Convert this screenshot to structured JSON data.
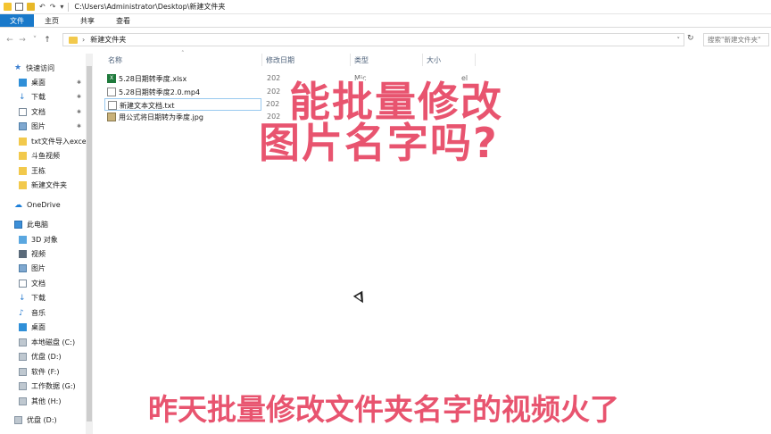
{
  "window": {
    "title_path": "C:\\Users\\Administrator\\Desktop\\新建文件夹"
  },
  "ribbon": {
    "tabs": [
      {
        "label": "文件"
      },
      {
        "label": "主页"
      },
      {
        "label": "共享"
      },
      {
        "label": "查看"
      }
    ]
  },
  "address": {
    "current": "新建文件夹",
    "search_placeholder": "搜索\"新建文件夹\""
  },
  "nav": {
    "items": [
      {
        "label": "快速访问",
        "icon": "star-icon"
      },
      {
        "label": "桌面",
        "icon": "desktop-icon"
      },
      {
        "label": "下载",
        "icon": "download-icon"
      },
      {
        "label": "文档",
        "icon": "document-icon"
      },
      {
        "label": "图片",
        "icon": "pictures-icon"
      },
      {
        "label": "txt文件导入excel",
        "icon": "folder-icon"
      },
      {
        "label": "斗鱼视频",
        "icon": "folder-icon"
      },
      {
        "label": "王栋",
        "icon": "folder-icon"
      },
      {
        "label": "新建文件夹",
        "icon": "folder-icon"
      },
      {
        "label": "OneDrive",
        "icon": "cloud-icon"
      },
      {
        "label": "此电脑",
        "icon": "computer-icon"
      },
      {
        "label": "3D 对象",
        "icon": "3d-objects-icon"
      },
      {
        "label": "视频",
        "icon": "video-icon"
      },
      {
        "label": "图片",
        "icon": "pictures-icon"
      },
      {
        "label": "文档",
        "icon": "document-icon"
      },
      {
        "label": "下载",
        "icon": "download-icon"
      },
      {
        "label": "音乐",
        "icon": "music-icon"
      },
      {
        "label": "桌面",
        "icon": "desktop-icon"
      },
      {
        "label": "本地磁盘 (C:)",
        "icon": "drive-icon"
      },
      {
        "label": "优盘 (D:)",
        "icon": "drive-icon"
      },
      {
        "label": "软件 (F:)",
        "icon": "drive-icon"
      },
      {
        "label": "工作数据 (G:)",
        "icon": "drive-icon"
      },
      {
        "label": "其他 (H:)",
        "icon": "drive-icon"
      },
      {
        "label": "优盘 (D:)",
        "icon": "drive-icon"
      }
    ]
  },
  "columns": {
    "name": "名称",
    "date": "修改日期",
    "type": "类型",
    "size": "大小"
  },
  "files": [
    {
      "name": "5.28日期转季度.xlsx",
      "date": "202",
      "type": "Mic",
      "size": "el",
      "icon": "excel-icon"
    },
    {
      "name": "5.28日期转季度2.0.mp4",
      "date": "202",
      "type": "",
      "size": "",
      "icon": "video-file-icon"
    },
    {
      "name": "新建文本文档.txt",
      "date": "202",
      "type": "",
      "size": "",
      "icon": "text-file-icon"
    },
    {
      "name": "用公式将日期转为季度.jpg",
      "date": "202",
      "type": "",
      "size": "",
      "icon": "image-file-icon"
    }
  ],
  "captions": {
    "line1": "能批量修改",
    "line2": "图片名字吗?",
    "bottom": "昨天批量修改文件夹名字的视频火了"
  },
  "colors": {
    "accent": "#1979ca",
    "caption": "#e8546f"
  }
}
